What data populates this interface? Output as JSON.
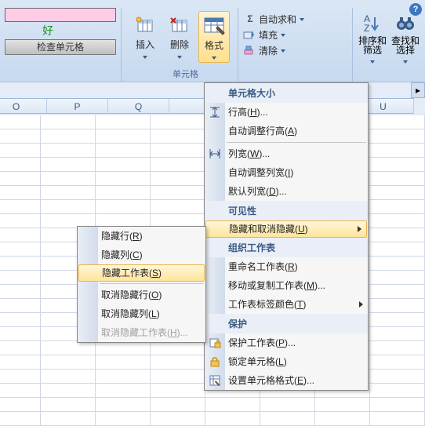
{
  "ribbon": {
    "help_tooltip": "?",
    "green_word": "好",
    "check_cells": "检查单元格",
    "insert": "插入",
    "delete": "删除",
    "format": "格式",
    "autosum": "自动求和",
    "fill": "填充",
    "clear": "清除",
    "sort_filter": "排序和\n筛选",
    "find_select": "查找和\n选择",
    "group_cells": "单元格"
  },
  "columns": [
    "O",
    "P",
    "Q",
    "",
    "",
    "",
    "U"
  ],
  "format_menu": {
    "sec_size": "单元格大小",
    "row_height": "行高(H)...",
    "autofit_row": "自动调整行高(A)",
    "col_width": "列宽(W)...",
    "autofit_col": "自动调整列宽(I)",
    "default_width": "默认列宽(D)...",
    "sec_vis": "可见性",
    "hide_unhide": "隐藏和取消隐藏(U)",
    "sec_org": "组织工作表",
    "rename": "重命名工作表(R)",
    "move_copy": "移动或复制工作表(M)...",
    "tab_color": "工作表标签颜色(T)",
    "sec_protect": "保护",
    "protect_sheet": "保护工作表(P)...",
    "lock_cell": "锁定单元格(L)",
    "format_cells": "设置单元格格式(E)..."
  },
  "sub_menu": {
    "hide_rows": "隐藏行(R)",
    "hide_cols": "隐藏列(C)",
    "hide_sheet": "隐藏工作表(S)",
    "unhide_rows": "取消隐藏行(O)",
    "unhide_cols": "取消隐藏列(L)",
    "unhide_sheet": "取消隐藏工作表(H)..."
  }
}
